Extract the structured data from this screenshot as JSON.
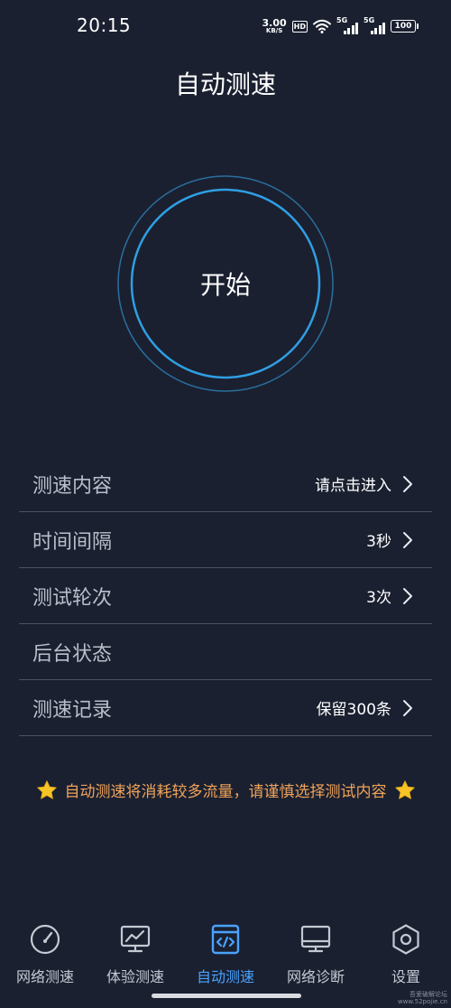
{
  "status_bar": {
    "time": "20:15",
    "net_speed_value": "3.00",
    "net_speed_unit": "KB/S",
    "hd_badge": "HD",
    "signal_1_label": "5G",
    "signal_2_label": "5G",
    "battery_level": "100",
    "wifi_icon": "wifi-icon"
  },
  "header": {
    "title": "自动测速"
  },
  "dial": {
    "start_label": "开始",
    "ring_color": "#2f9fe3"
  },
  "settings": [
    {
      "label": "测速内容",
      "value": "请点击进入",
      "has_chevron": true
    },
    {
      "label": "时间间隔",
      "value": "3秒",
      "has_chevron": true
    },
    {
      "label": "测试轮次",
      "value": "3次",
      "has_chevron": true
    },
    {
      "label": "后台状态",
      "value": "",
      "has_chevron": false
    },
    {
      "label": "测速记录",
      "value": "保留300条",
      "has_chevron": true
    }
  ],
  "notice": {
    "text": "自动测速将消耗较多流量，请谨慎选择测试内容",
    "icon": "star-icon",
    "color": "#f0a35a"
  },
  "bottom_nav": [
    {
      "label": "网络测速",
      "icon": "speedometer-icon",
      "active": false
    },
    {
      "label": "体验测速",
      "icon": "chart-monitor-icon",
      "active": false
    },
    {
      "label": "自动测速",
      "icon": "code-window-icon",
      "active": true
    },
    {
      "label": "网络诊断",
      "icon": "monitor-icon",
      "active": false
    },
    {
      "label": "设置",
      "icon": "hexagon-gear-icon",
      "active": false
    }
  ],
  "watermark": {
    "line1": "吾爱破解论坛",
    "line2": "www.52pojie.cn"
  },
  "colors": {
    "background": "#1a2030",
    "accent": "#4aa3ff",
    "divider": "#4a5262",
    "warning": "#f0a35a"
  }
}
